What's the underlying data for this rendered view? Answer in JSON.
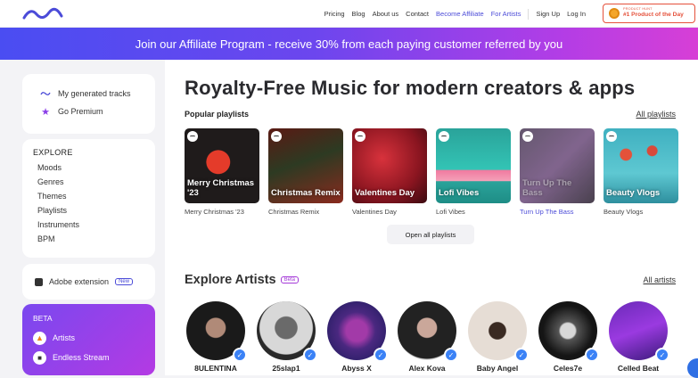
{
  "nav": {
    "links": [
      "Pricing",
      "Blog",
      "About us",
      "Contact"
    ],
    "become_affiliate": "Become Affiliate",
    "for_artists": "For Artists",
    "sign_up": "Sign Up",
    "log_in": "Log In",
    "ph_small": "PRODUCT HUNT",
    "ph_big": "#1 Product of the Day"
  },
  "banner": {
    "text": "Join our Affiliate Program - receive 30% from each paying customer referred by you"
  },
  "sidebar": {
    "generated_tracks": "My generated tracks",
    "go_premium": "Go Premium",
    "explore_title": "EXPLORE",
    "explore_items": [
      "Moods",
      "Genres",
      "Themes",
      "Playlists",
      "Instruments",
      "BPM"
    ],
    "adobe_extension": "Adobe extension",
    "new_badge": "New",
    "beta_title": "BETA",
    "artists": "Artists",
    "endless_stream": "Endless Stream"
  },
  "main": {
    "hero": "Royalty-Free Music for modern creators & apps",
    "popular_playlists": "Popular playlists",
    "all_playlists": "All playlists",
    "playlists": [
      {
        "title": "Merry Christmas '23",
        "caption": "Merry Christmas '23"
      },
      {
        "title": "Christmas Remix",
        "caption": "Christmas Remix"
      },
      {
        "title": "Valentines Day",
        "caption": "Valentines Day"
      },
      {
        "title": "Lofi Vibes",
        "caption": "Lofi Vibes"
      },
      {
        "title": "Turn Up The Bass",
        "caption": "Turn Up The Bass"
      },
      {
        "title": "Beauty Vlogs",
        "caption": "Beauty Vlogs"
      }
    ],
    "open_all": "Open all playlists",
    "explore_artists": "Explore Artists",
    "beta_badge": "Beta",
    "all_artists": "All artists",
    "artists": [
      "8ULENTINA",
      "25slap1",
      "Abyss X",
      "Alex Kova",
      "Baby Angel",
      "Celes7e",
      "Celled Beat"
    ]
  },
  "colors": {
    "accent": "#4b4bd8",
    "banner_start": "#4a4df2",
    "banner_end": "#d73fd6",
    "beta_card": "#9a42ea",
    "verified": "#3b82f6"
  }
}
